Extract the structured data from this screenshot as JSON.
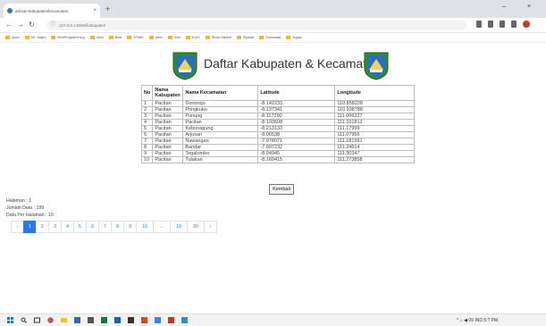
{
  "browser": {
    "tab_title": "artisan-kabupaten/kecamatan",
    "new_tab_label": "+",
    "url": "127.0.0.1:8000/kabupaten",
    "bookmarks": [
      "Apps",
      "Mr. Jaaps",
      "WebProgramming",
      "Java",
      "Bola",
      "STMIK",
      "amis",
      "mini",
      "KUIS",
      "Stock Market",
      "Riparat",
      "Download",
      "Tugas"
    ]
  },
  "page": {
    "title": "Daftar Kabupaten & Kecamatan",
    "headers": [
      "No",
      "Nama Kabupaten",
      "Nama Kecamatan",
      "Latitude",
      "Longitude"
    ],
    "rows": [
      [
        "1",
        "Pacitan",
        "Donorojo",
        "-8.142233",
        "110.858228"
      ],
      [
        "2",
        "Pacitan",
        "Pringkuku",
        "-8.137341",
        "110.938788"
      ],
      [
        "3",
        "Pacitan",
        "Punung",
        "-8.117290",
        "111.006227"
      ],
      [
        "4",
        "Pacitan",
        "Pacitan",
        "-8.193608",
        "111.101812"
      ],
      [
        "5",
        "Pacitan",
        "Kebonagung",
        "-8.213133",
        "111.17999"
      ],
      [
        "6",
        "Pacitan",
        "Arjosari",
        "-8.06538",
        "111.07956"
      ],
      [
        "7",
        "Pacitan",
        "Nawangan",
        "-7.978071",
        "111.181991"
      ],
      [
        "8",
        "Pacitan",
        "Bandar",
        "-7.997232",
        "111.24614"
      ],
      [
        "9",
        "Pacitan",
        "Tegalombo",
        "-8.04945",
        "111.30347"
      ],
      [
        "10",
        "Pacitan",
        "Tulakan",
        "-8.169415",
        "111.273858"
      ]
    ],
    "back_button": "Kembali",
    "info": [
      "Halaman : 1",
      "Jumlah Data : 199",
      "Data Per Halaman : 10"
    ],
    "pagination": [
      "‹",
      "1",
      "2",
      "3",
      "4",
      "5",
      "6",
      "7",
      "8",
      "9",
      "10",
      "...",
      "19",
      "20",
      "›"
    ],
    "active_page": "1"
  },
  "taskbar": {
    "tray_text": "^ ⌂ ◀ 09 IND 5:? PM"
  },
  "colors": {
    "accent": "#2c77e0",
    "logo_green": "#2e8b3a",
    "logo_blue": "#2a6fb8"
  }
}
